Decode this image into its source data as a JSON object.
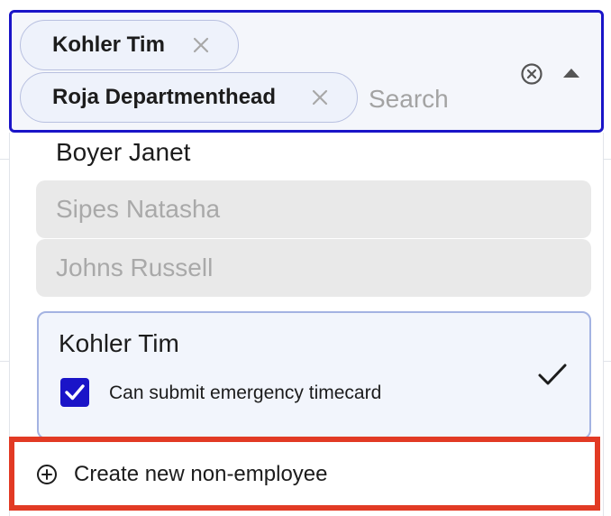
{
  "select": {
    "chips": [
      {
        "label": "Kohler Tim",
        "remove_icon": "close-icon"
      },
      {
        "label": "Roja Departmenthead",
        "remove_icon": "close-icon"
      }
    ],
    "search": {
      "placeholder": "Search",
      "value": ""
    },
    "clear_icon": "circle-x-icon",
    "toggle_icon": "caret-up-icon",
    "accent_color": "#1a14c8"
  },
  "dropdown": {
    "options": [
      {
        "label": "Boyer Janet",
        "state": "enabled"
      },
      {
        "label": "Sipes Natasha",
        "state": "disabled"
      },
      {
        "label": "Johns Russell",
        "state": "disabled"
      }
    ],
    "selected_option": {
      "label": "Kohler Tim",
      "checkbox_label": "Can submit emergency timecard",
      "checkbox_checked": true,
      "selected_icon": "checkmark-icon"
    },
    "create_new": {
      "label": "Create new non-employee",
      "icon": "plus-circle-icon",
      "highlight_color": "#e23a24"
    }
  }
}
